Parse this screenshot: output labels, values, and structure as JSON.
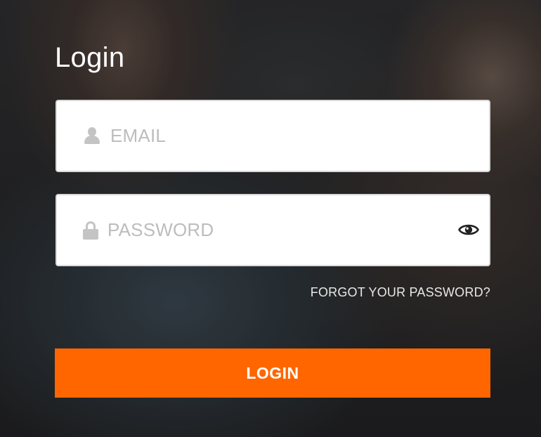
{
  "form": {
    "title": "Login",
    "email": {
      "placeholder": "EMAIL",
      "value": "",
      "icon": "user-icon"
    },
    "password": {
      "placeholder": "PASSWORD",
      "value": "",
      "icon": "lock-icon",
      "toggle_icon": "eye-icon"
    },
    "forgot_link": "FORGOT YOUR PASSWORD?",
    "submit_label": "LOGIN"
  },
  "colors": {
    "accent": "#ff6600",
    "field_background": "#ffffff",
    "placeholder": "#bdbdbd",
    "icon": "#c4c4c4",
    "text_light": "#ffffff"
  }
}
